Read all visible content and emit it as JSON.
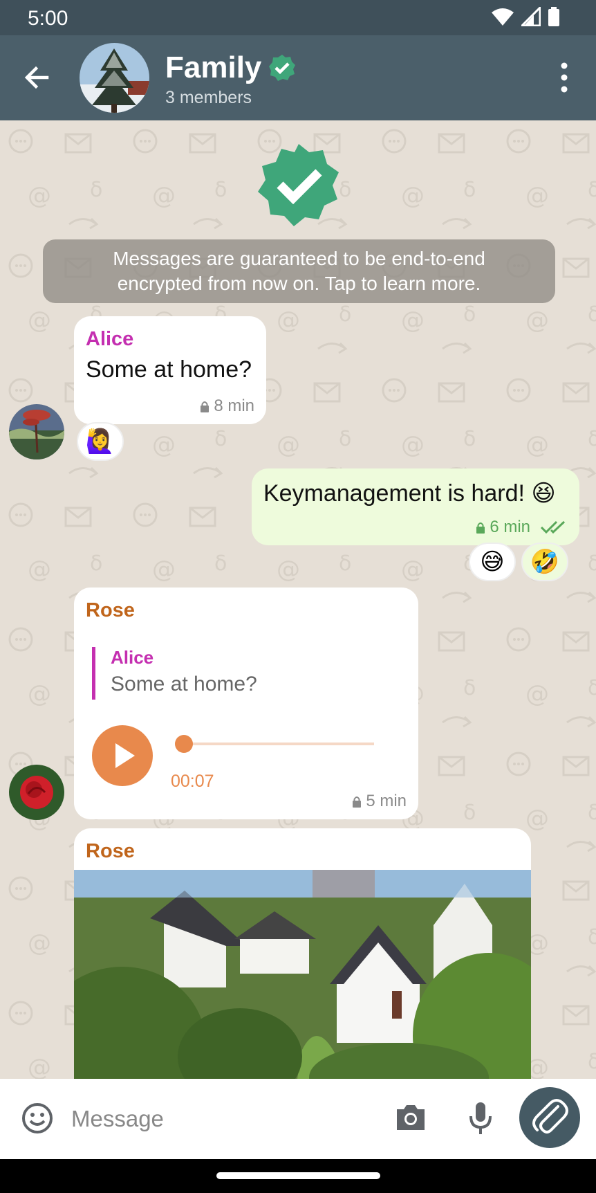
{
  "status_bar": {
    "time": "5:00",
    "icons": [
      "wifi-icon",
      "signal-icon",
      "battery-icon"
    ]
  },
  "header": {
    "title": "Family",
    "subtitle": "3 members",
    "verified_icon": "verified-badge-icon",
    "back_icon": "arrow-left-icon",
    "menu_icon": "more-vertical-icon"
  },
  "chat": {
    "encryption_notice_line1": "Messages are guaranteed to be end-to-end",
    "encryption_notice_line2": "encrypted from now on. Tap to learn more.",
    "messages": [
      {
        "sender": "Alice",
        "text": "Some at home?",
        "time": "8 min",
        "reactions": [
          "🙋‍♀️"
        ],
        "sender_color": "#c42fb0"
      },
      {
        "direction": "outgoing",
        "text": "Keymanagement is hard! 😆",
        "time": "6 min",
        "reactions": [
          "😅",
          "🤣"
        ]
      },
      {
        "sender": "Rose",
        "sender_color": "#c0651b",
        "quote_sender": "Alice",
        "quote_text": "Some at home?",
        "voice_duration": "00:07",
        "voice_progress": 0,
        "time": "5 min"
      },
      {
        "sender": "Rose",
        "sender_color": "#c0651b",
        "type": "image"
      }
    ]
  },
  "input_bar": {
    "placeholder": "Message",
    "icons": [
      "emoji-icon",
      "camera-icon",
      "microphone-icon",
      "attachment-icon"
    ]
  },
  "colors": {
    "app_bar": "#4b5f6a",
    "status_bar": "#3f505a",
    "accent_green": "#3fa67a",
    "outgoing_bubble": "#eefbdc",
    "voice_accent": "#e8894c"
  }
}
